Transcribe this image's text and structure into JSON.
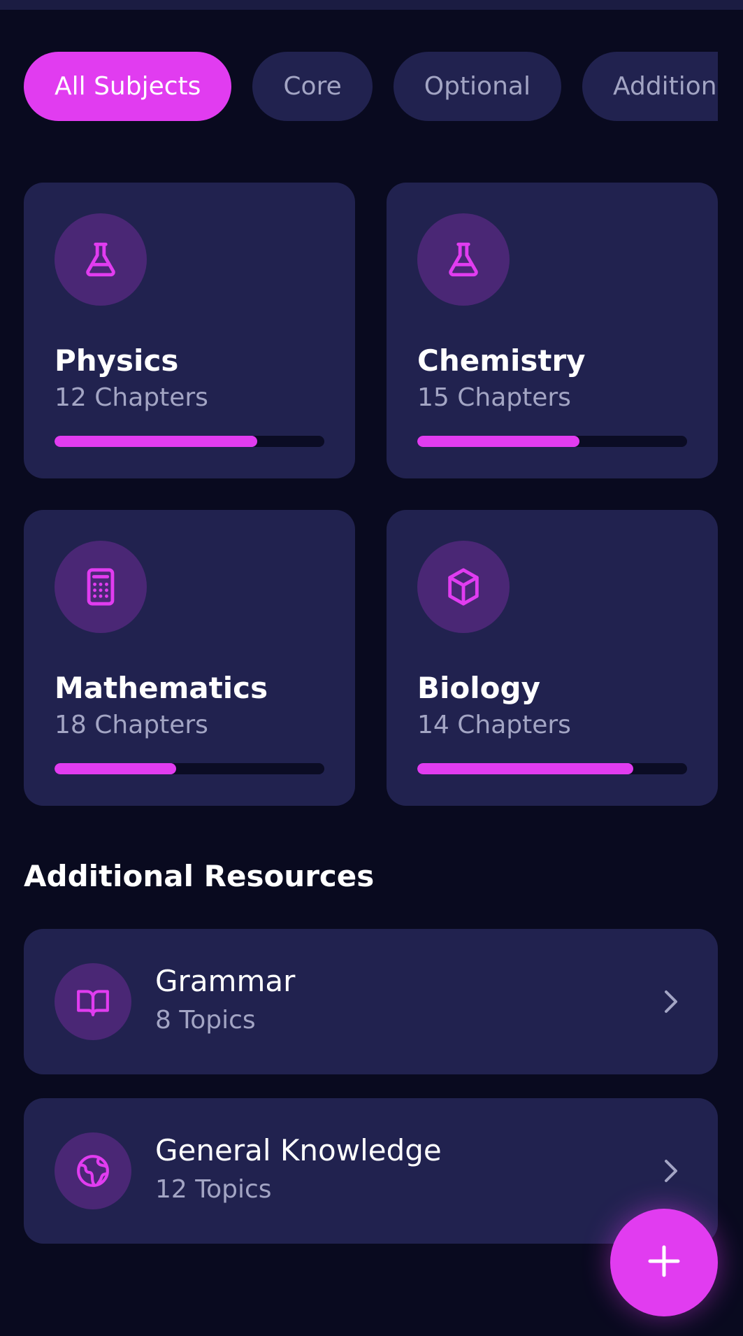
{
  "filters": {
    "chips": [
      {
        "label": "All Subjects",
        "active": true
      },
      {
        "label": "Core",
        "active": false
      },
      {
        "label": "Optional",
        "active": false
      },
      {
        "label": "Additional",
        "active": false
      }
    ]
  },
  "subjects": [
    {
      "name": "Physics",
      "count": "12 Chapters",
      "icon": "flask-icon",
      "progress": 0.75
    },
    {
      "name": "Chemistry",
      "count": "15 Chapters",
      "icon": "flask-icon",
      "progress": 0.6
    },
    {
      "name": "Mathematics",
      "count": "18 Chapters",
      "icon": "calculator-icon",
      "progress": 0.45
    },
    {
      "name": "Biology",
      "count": "14 Chapters",
      "icon": "cube-icon",
      "progress": 0.8
    }
  ],
  "resources": {
    "title": "Additional Resources",
    "items": [
      {
        "name": "Grammar",
        "count": "8 Topics",
        "icon": "book-open-icon"
      },
      {
        "name": "General Knowledge",
        "count": "12 Topics",
        "icon": "globe-icon"
      }
    ]
  },
  "colors": {
    "background": "#090a1f",
    "card": "#21224f",
    "accent": "#e13cf0",
    "icon_bg": "#4a2775",
    "muted_text": "#a3a5c4"
  },
  "fab": {
    "icon": "plus-icon"
  }
}
